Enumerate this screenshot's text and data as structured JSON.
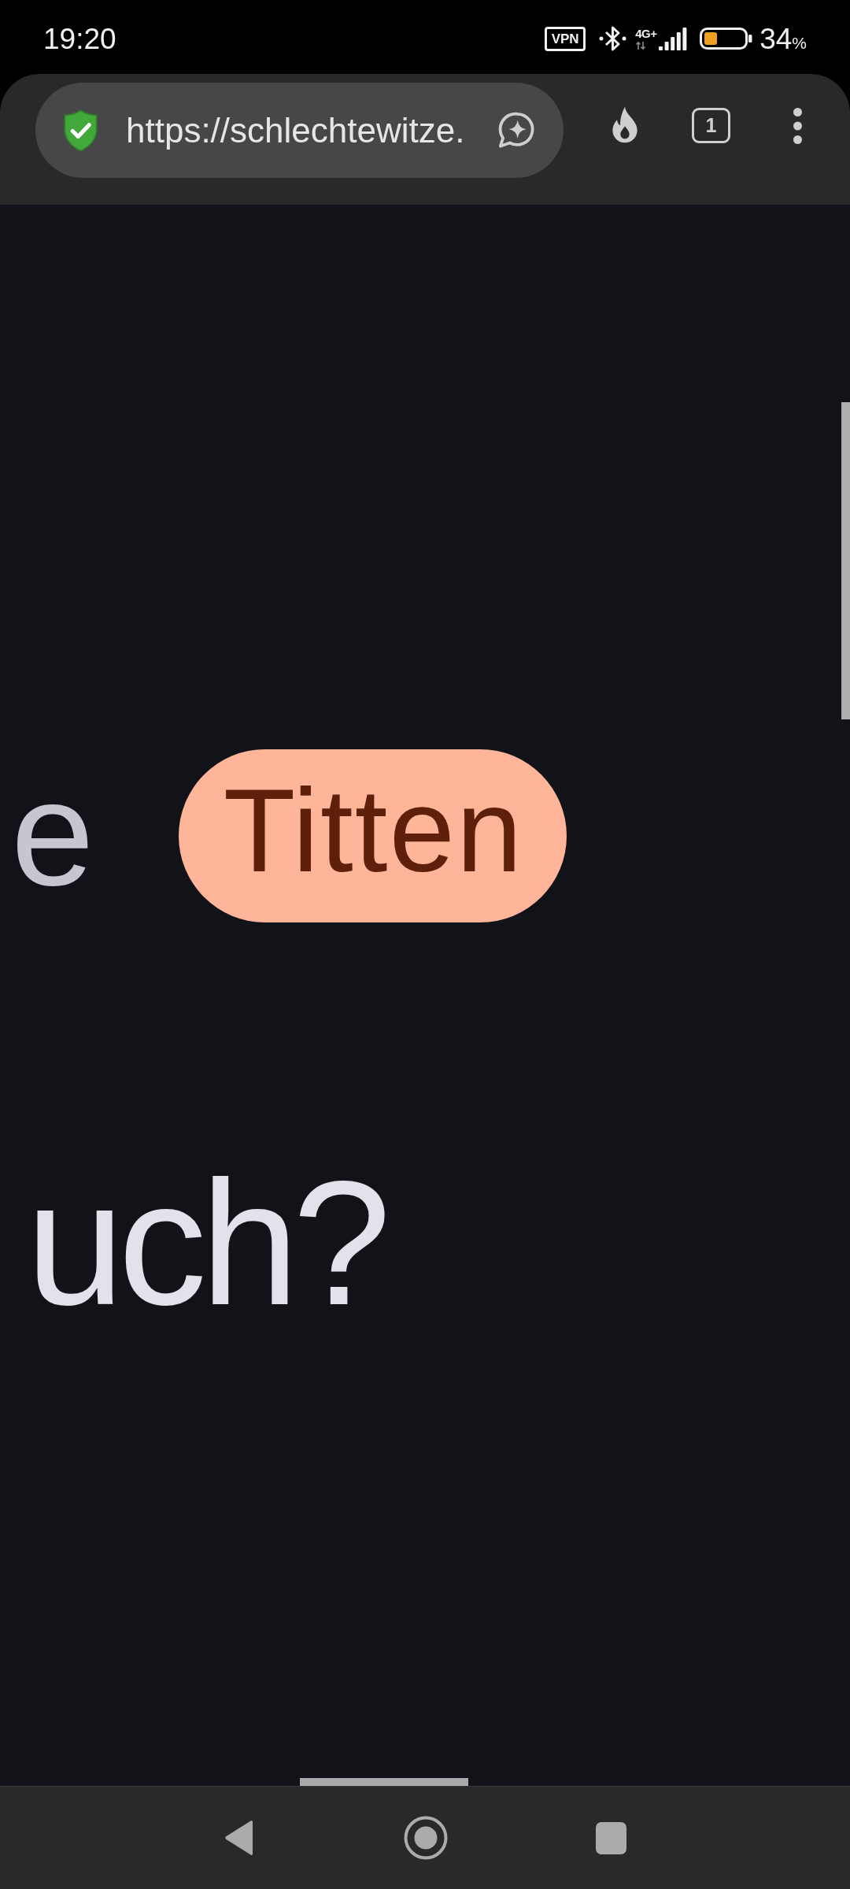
{
  "status_bar": {
    "time": "19:20",
    "vpn": "VPN",
    "network_type": "4G+",
    "battery": {
      "percent": "34",
      "unit": "%"
    }
  },
  "toolbar": {
    "url": "https://schlechtewitze.",
    "tab_count": "1"
  },
  "content": {
    "lines": [
      {
        "segments": [
          {
            "kind": "faded",
            "text": "e"
          },
          {
            "kind": "highlight",
            "text": "Titten"
          }
        ]
      },
      {
        "segments": [
          {
            "kind": "plain",
            "text": "uch?"
          }
        ]
      }
    ]
  }
}
